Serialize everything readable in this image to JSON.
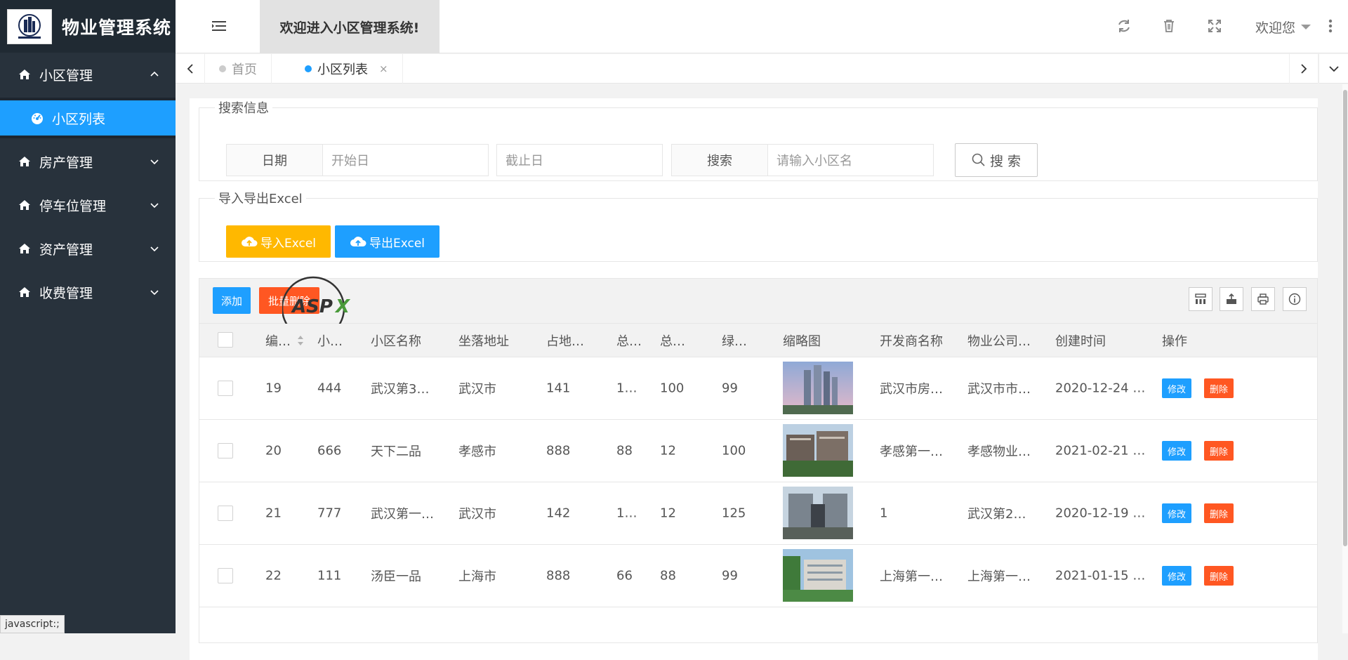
{
  "app": {
    "title": "物业管理系统",
    "welcome": "欢迎进入小区管理系统!",
    "greeting": "欢迎您"
  },
  "sidebar": {
    "items": [
      {
        "label": "小区管理",
        "expanded": true
      },
      {
        "label": "房产管理",
        "expanded": false
      },
      {
        "label": "停车位管理",
        "expanded": false
      },
      {
        "label": "资产管理",
        "expanded": false
      },
      {
        "label": "收费管理",
        "expanded": false
      }
    ],
    "active_sub": "小区列表"
  },
  "tabs": [
    {
      "label": "首页",
      "active": false
    },
    {
      "label": "小区列表",
      "active": true,
      "close": "×"
    }
  ],
  "search": {
    "legend": "搜索信息",
    "date_label": "日期",
    "start_placeholder": "开始日",
    "end_placeholder": "截止日",
    "search_label": "搜索",
    "name_placeholder": "请输入小区名",
    "button": "搜 索"
  },
  "excel": {
    "legend": "导入导出Excel",
    "import": "导入Excel",
    "export": "导出Excel"
  },
  "table": {
    "add": "添加",
    "batch_delete": "批量删除",
    "columns": [
      "编…",
      "小…",
      "小区名称",
      "坐落地址",
      "占地…",
      "总…",
      "总…",
      "绿…",
      "缩略图",
      "开发商名称",
      "物业公司…",
      "创建时间",
      "操作"
    ],
    "edit_label": "修改",
    "delete_label": "删除",
    "rows": [
      {
        "id": "19",
        "code": "444",
        "name": "武汉第3…",
        "address": "武汉市",
        "area": "141",
        "total1": "1…",
        "total2": "100",
        "green": "99",
        "developer": "武汉市房…",
        "property": "武汉市市…",
        "created": "2020-12-24 …"
      },
      {
        "id": "20",
        "code": "666",
        "name": "天下二品",
        "address": "孝感市",
        "area": "888",
        "total1": "88",
        "total2": "12",
        "green": "100",
        "developer": "孝感第一…",
        "property": "孝感物业…",
        "created": "2021-02-21 …"
      },
      {
        "id": "21",
        "code": "777",
        "name": "武汉第一…",
        "address": "武汉市",
        "area": "142",
        "total1": "1…",
        "total2": "12",
        "green": "125",
        "developer": "1",
        "property": "武汉第2…",
        "created": "2020-12-19 …"
      },
      {
        "id": "22",
        "code": "111",
        "name": "汤臣一品",
        "address": "上海市",
        "area": "888",
        "total1": "66",
        "total2": "88",
        "green": "99",
        "developer": "上海第一…",
        "property": "上海第一…",
        "created": "2021-01-15 …"
      }
    ]
  },
  "status_tip": "javascript:;",
  "colors": {
    "primary": "#1e9fff",
    "warning": "#ffb800",
    "danger": "#ff5722",
    "sidebar": "#28323c"
  }
}
